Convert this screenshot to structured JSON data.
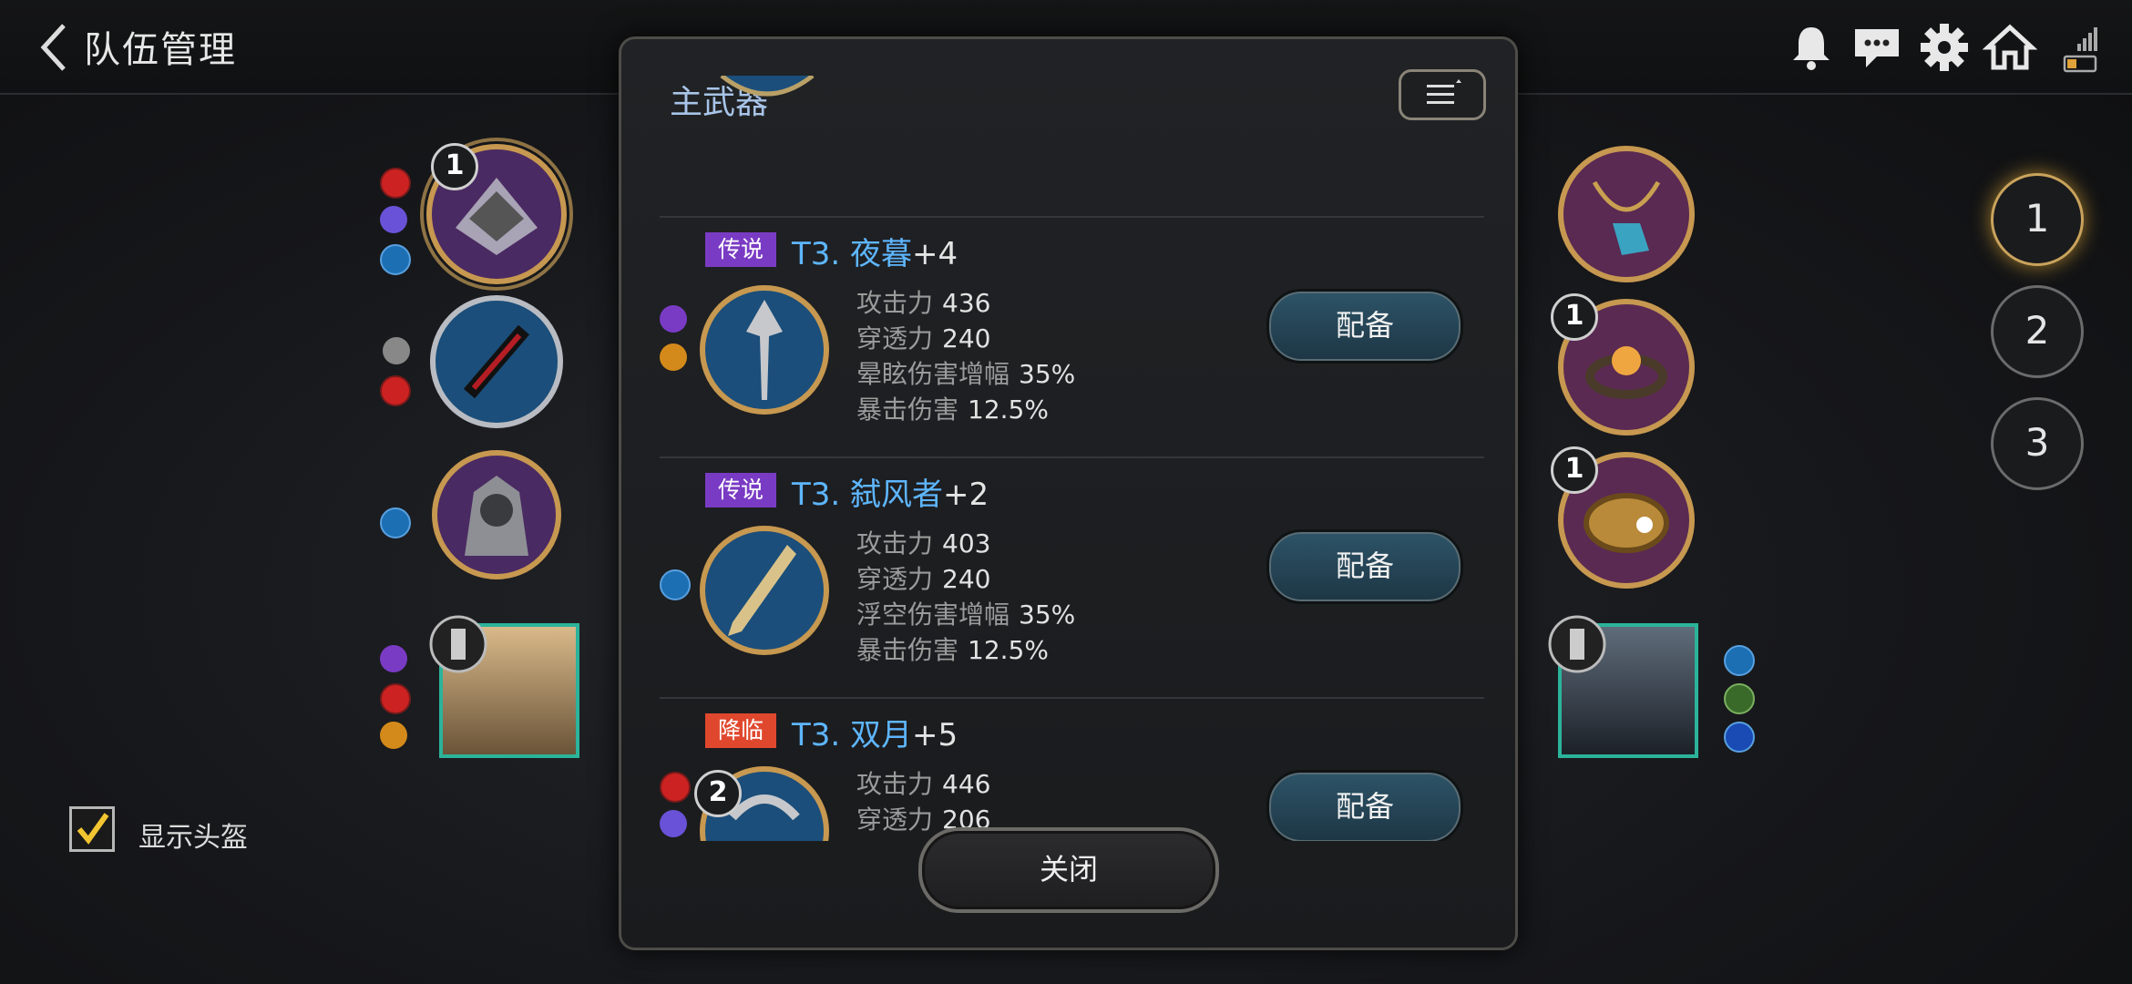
{
  "header": {
    "title": "队伍管理"
  },
  "panel": {
    "title": "主武器",
    "items": [
      {
        "rarity": "传说",
        "rarity_color": "#7a3bc4",
        "tier": "T3.",
        "name": "夜暮",
        "plus": "+4",
        "stats": [
          {
            "label": "攻击力",
            "value": "436"
          },
          {
            "label": "穿透力",
            "value": "240"
          },
          {
            "label": "晕眩伤害增幅",
            "value": "35%"
          },
          {
            "label": "暴击伤害",
            "value": "12.5%"
          }
        ],
        "equip_label": "配备"
      },
      {
        "rarity": "传说",
        "rarity_color": "#7a3bc4",
        "tier": "T3.",
        "name": "弑风者",
        "plus": "+2",
        "stats": [
          {
            "label": "攻击力",
            "value": "403"
          },
          {
            "label": "穿透力",
            "value": "240"
          },
          {
            "label": "浮空伤害增幅",
            "value": "35%"
          },
          {
            "label": "暴击伤害",
            "value": "12.5%"
          }
        ],
        "equip_label": "配备"
      },
      {
        "rarity": "降临",
        "rarity_color": "#e0482e",
        "tier": "T3.",
        "name": "双月",
        "plus": "+5",
        "badge": "2",
        "stats": [
          {
            "label": "攻击力",
            "value": "446"
          },
          {
            "label": "穿透力",
            "value": "206"
          }
        ],
        "equip_label": "配备"
      }
    ],
    "close_label": "关闭"
  },
  "left_equipment": {
    "weapon_badge": "1"
  },
  "right_equipment": {
    "ring_badge": "1",
    "bracelet_badge": "1"
  },
  "show_helmet": {
    "label": "显示头盔",
    "checked": true
  },
  "team_slots": [
    "1",
    "2",
    "3"
  ],
  "active_slot": "1"
}
